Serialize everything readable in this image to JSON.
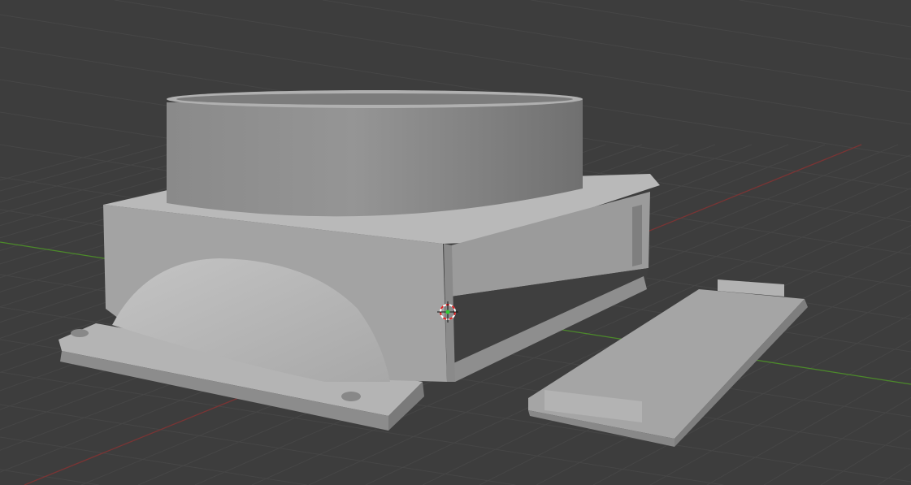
{
  "viewport": {
    "name": "3D Viewport",
    "background": "#3d3d3d",
    "grid_color": "#4a4a4a",
    "x_axis_color": "#8a3a3a",
    "y_axis_color": "#4e8a2a",
    "model_color": "#9a9a9a"
  },
  "icons": {
    "cursor": "3d-cursor-icon"
  }
}
